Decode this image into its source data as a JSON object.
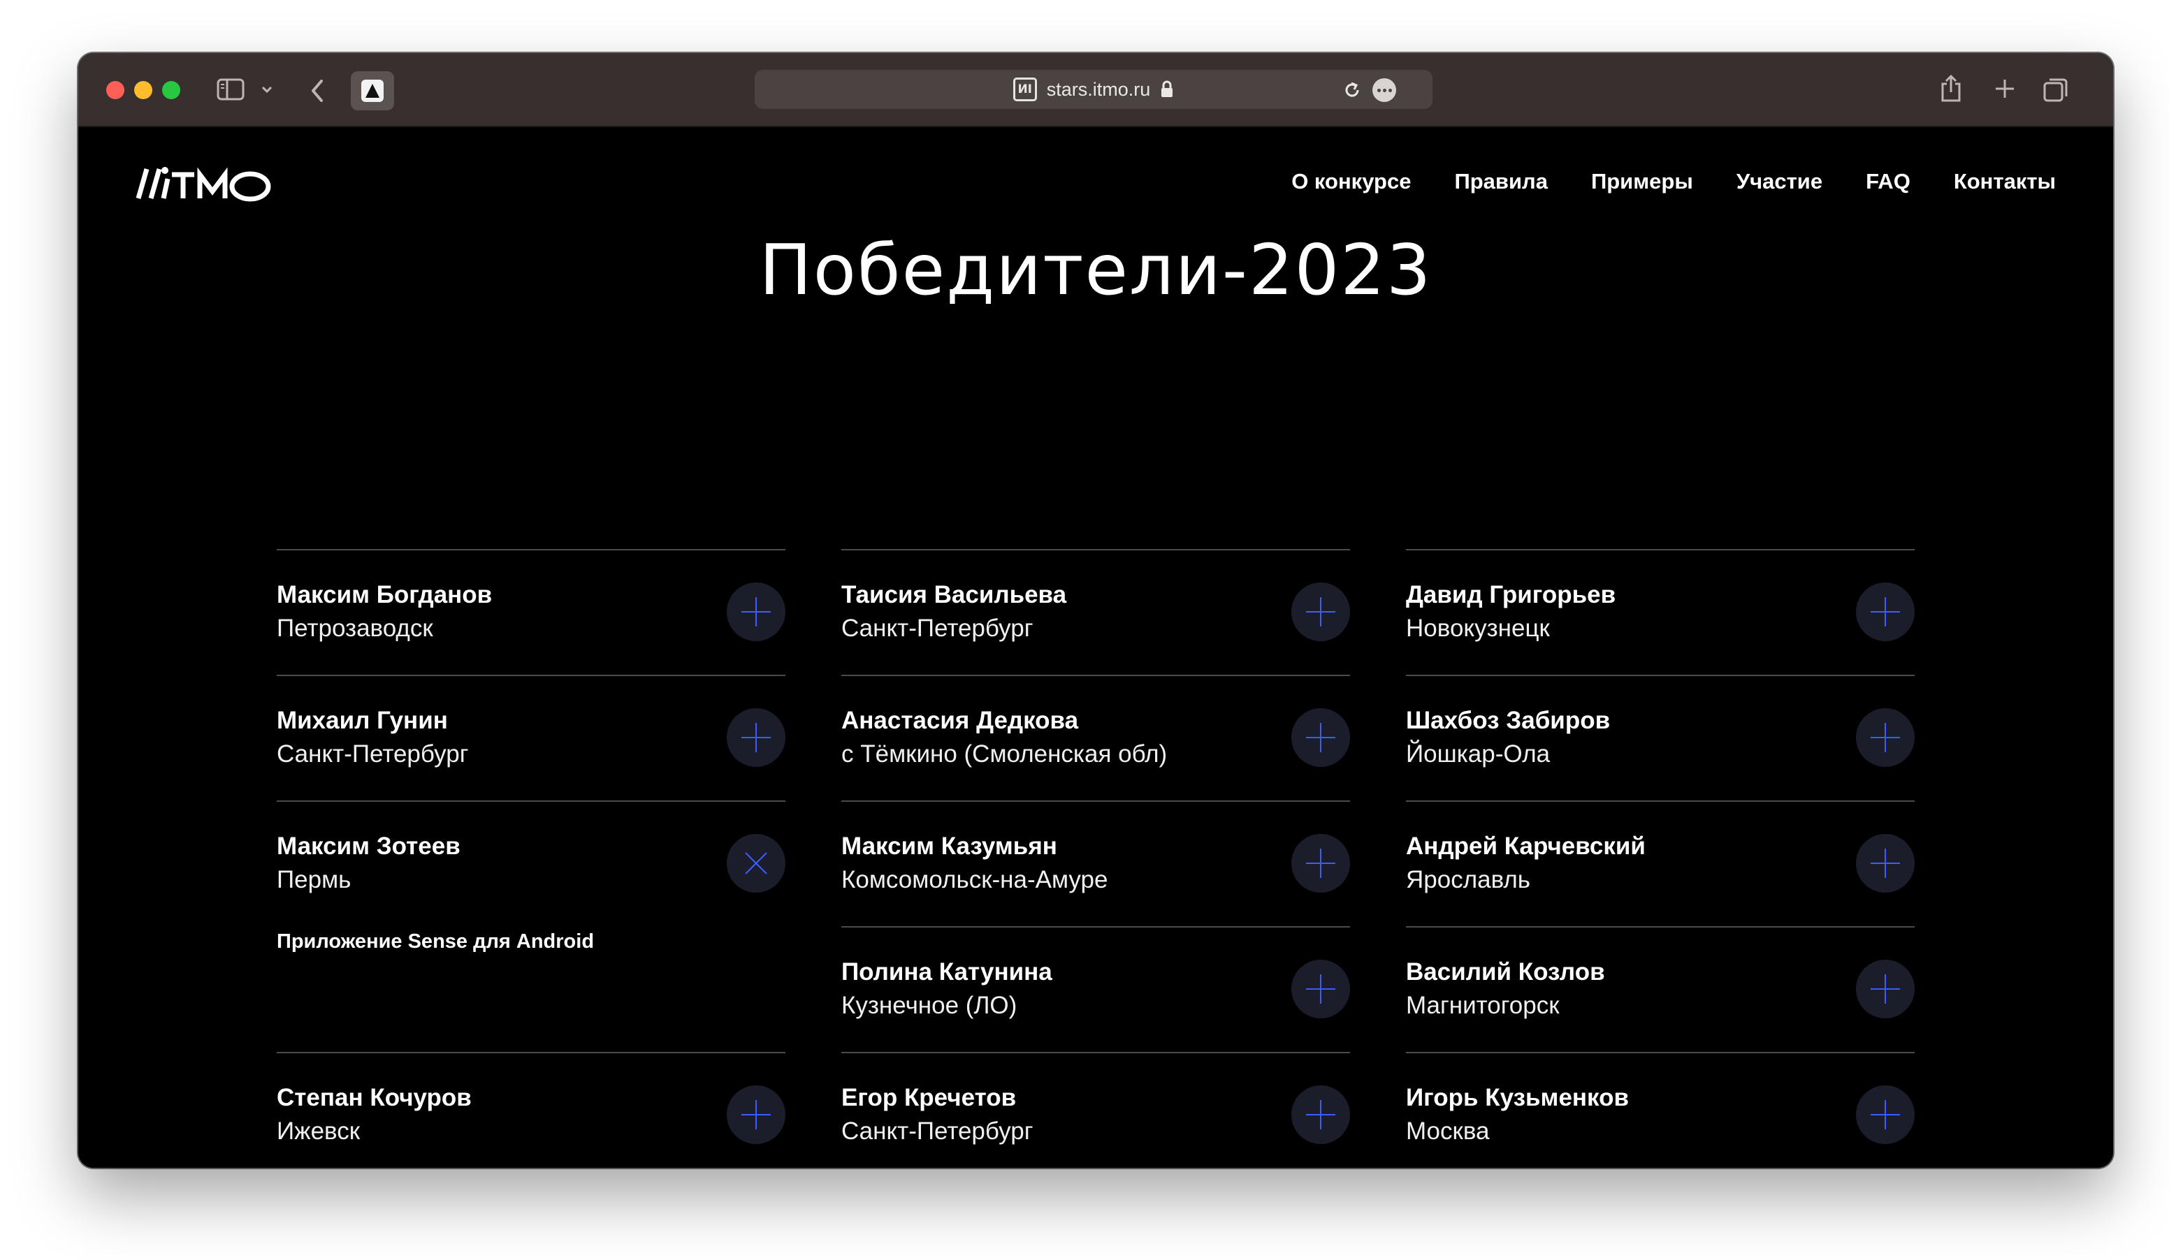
{
  "browser": {
    "url": "stars.itmo.ru",
    "site_icon_text": "ИI"
  },
  "site": {
    "logo": "ИТМО",
    "nav": [
      "О конкурсе",
      "Правила",
      "Примеры",
      "Участие",
      "FAQ",
      "Контакты"
    ]
  },
  "main": {
    "title": "Победители-2023",
    "columns": [
      [
        {
          "name": "Максим Богданов",
          "city": "Петрозаводск",
          "expanded": false
        },
        {
          "name": "Михаил Гунин",
          "city": "Санкт-Петербург",
          "expanded": false
        },
        {
          "name": "Максим Зотеев",
          "city": "Пермь",
          "expanded": true,
          "project": "Приложение Sense для Android"
        },
        {
          "name": "Степан Кочуров",
          "city": "Ижевск",
          "expanded": false
        }
      ],
      [
        {
          "name": "Таисия Васильева",
          "city": "Санкт-Петербург",
          "expanded": false
        },
        {
          "name": "Анастасия Дедкова",
          "city": "с Тёмкино (Смоленская обл)",
          "expanded": false
        },
        {
          "name": "Максим Казумьян",
          "city": "Комсомольск-на-Амуре",
          "expanded": false
        },
        {
          "name": "Полина Катунина",
          "city": "Кузнечное (ЛО)",
          "expanded": false
        },
        {
          "name": "Егор Кречетов",
          "city": "Санкт-Петербург",
          "expanded": false
        }
      ],
      [
        {
          "name": "Давид Григорьев",
          "city": "Новокузнецк",
          "expanded": false
        },
        {
          "name": "Шахбоз Забиров",
          "city": "Йошкар-Ола",
          "expanded": false
        },
        {
          "name": "Андрей Карчевский",
          "city": "Ярославль",
          "expanded": false
        },
        {
          "name": "Василий Козлов",
          "city": "Магнитогорск",
          "expanded": false
        },
        {
          "name": "Игорь Кузьменков",
          "city": "Москва",
          "expanded": false
        }
      ]
    ]
  },
  "colors": {
    "background": "#000000",
    "accent": "#3d5cff",
    "toggle_bg": "#1c1d2a",
    "divider": "#4b4b4b"
  }
}
